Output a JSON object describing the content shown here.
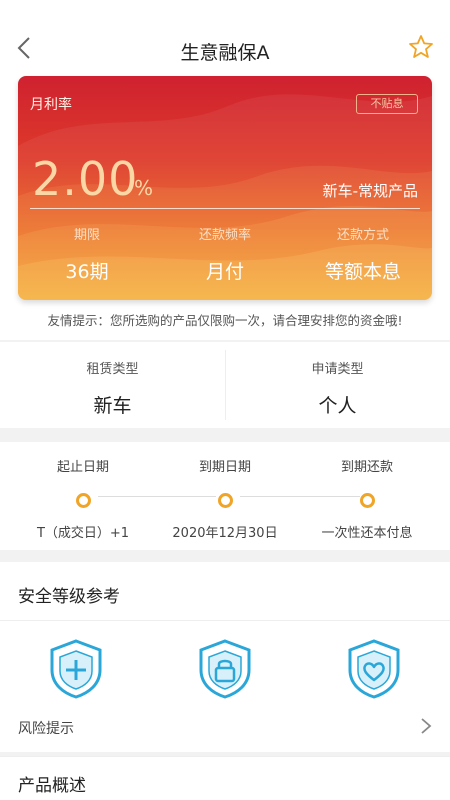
{
  "header": {
    "title": "生意融保A",
    "back_icon": "chevron-left-icon",
    "favorite_icon": "star-outline-icon"
  },
  "card": {
    "rate_label": "月利率",
    "badge": "不贴息",
    "rate_value": "2.00",
    "rate_unit": "%",
    "product_name": "新车-常规产品",
    "stats": [
      {
        "label": "期限",
        "value": "36期"
      },
      {
        "label": "还款频率",
        "value": "月付"
      },
      {
        "label": "还款方式",
        "value": "等额本息"
      }
    ]
  },
  "tip": "友情提示：您所选购的产品仅限购一次，请合理安排您的资金哦!",
  "types": [
    {
      "label": "租赁类型",
      "value": "新车"
    },
    {
      "label": "申请类型",
      "value": "个人"
    }
  ],
  "timeline": [
    {
      "label": "起止日期",
      "value": "T（成交日）+1"
    },
    {
      "label": "到期日期",
      "value": "2020年12月30日"
    },
    {
      "label": "到期还款",
      "value": "一次性还本付息"
    }
  ],
  "safety": {
    "title": "安全等级参考",
    "icons": [
      "shield-plus-icon",
      "shield-lock-icon",
      "shield-heart-icon"
    ],
    "risk_label": "风险提示",
    "risk_icon": "chevron-right-icon"
  },
  "overview": {
    "title": "产品概述"
  },
  "colors": {
    "card_top": "#cf2130",
    "card_bottom": "#f0a228",
    "accent_orange": "#f0a528",
    "icon_blue": "#2aa7d8",
    "star": "#f0a528"
  }
}
